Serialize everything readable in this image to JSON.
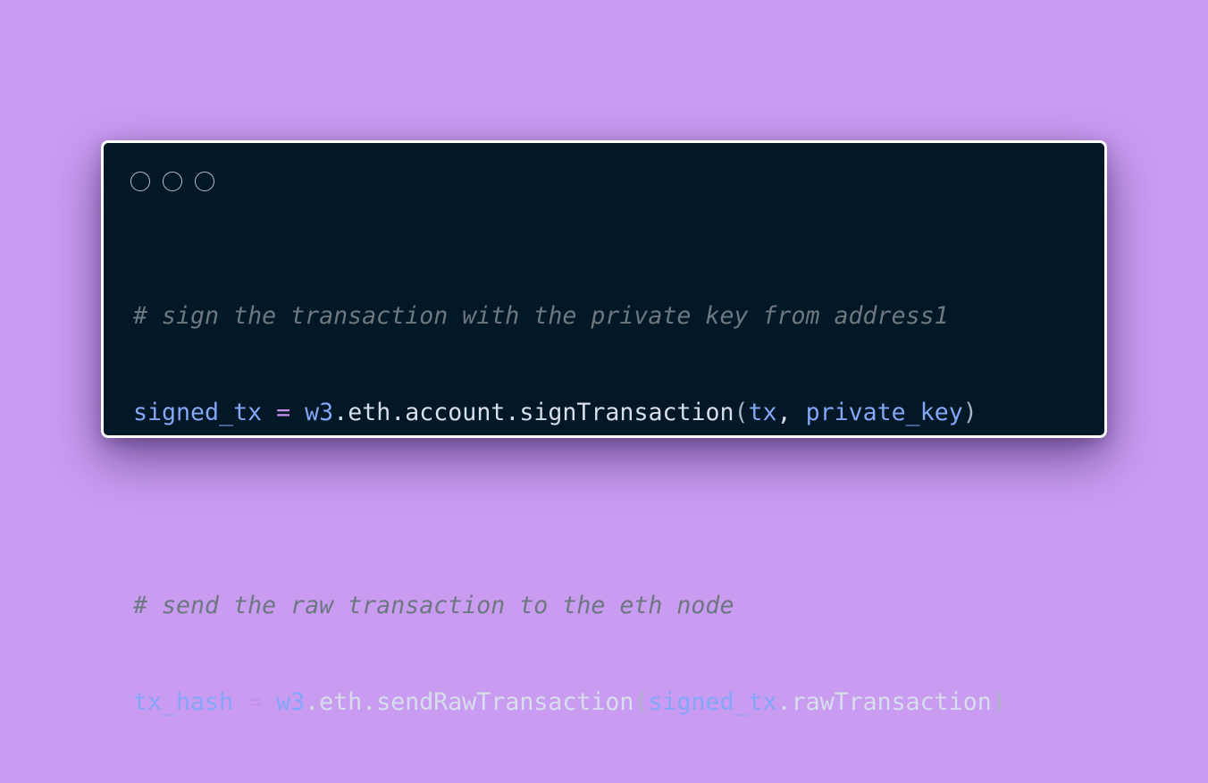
{
  "window": {
    "traffic_lights": [
      "close",
      "minimize",
      "maximize"
    ]
  },
  "code": {
    "line1_comment": "# sign the transaction with the private key from address1",
    "line2": {
      "var": "signed_tx",
      "eq": "=",
      "obj": "w3",
      "dot1": ".",
      "attr1": "eth",
      "dot2": ".",
      "attr2": "account",
      "dot3": ".",
      "method": "signTransaction",
      "open": "(",
      "arg1": "tx",
      "comma": ",",
      "arg2": "private_key",
      "close": ")"
    },
    "line4_comment": "# send the raw transaction to the eth node",
    "line5": {
      "var": "tx_hash",
      "eq": "=",
      "obj": "w3",
      "dot1": ".",
      "attr1": "eth",
      "dot2": ".",
      "method": "sendRawTransaction",
      "open": "(",
      "arg1": "signed_tx",
      "dot3": ".",
      "arg1_attr": "rawTransaction",
      "close": ")"
    }
  },
  "colors": {
    "background": "#c99cf2",
    "editor": "#021827",
    "comment": "#6d7780",
    "variable": "#83a6f7",
    "operator": "#c691ec",
    "text": "#d6deeb"
  }
}
